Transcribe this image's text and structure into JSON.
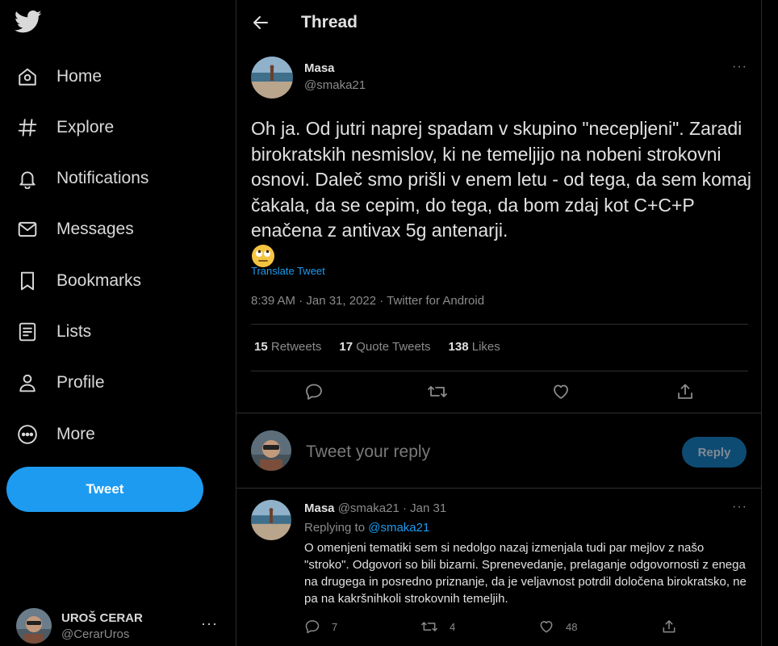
{
  "sidebar": {
    "logo_icon": "twitter-bird-icon",
    "items": [
      {
        "label": "Home",
        "icon": "home-icon"
      },
      {
        "label": "Explore",
        "icon": "hashtag-icon"
      },
      {
        "label": "Notifications",
        "icon": "bell-icon"
      },
      {
        "label": "Messages",
        "icon": "envelope-icon"
      },
      {
        "label": "Bookmarks",
        "icon": "bookmark-icon"
      },
      {
        "label": "Lists",
        "icon": "list-icon"
      },
      {
        "label": "Profile",
        "icon": "person-icon"
      },
      {
        "label": "More",
        "icon": "more-circle-icon"
      }
    ],
    "tweet_button": "Tweet",
    "account": {
      "name": "UROŠ CERAR",
      "handle": "@CerarUros",
      "more": "···"
    }
  },
  "header": {
    "title": "Thread",
    "back_icon": "arrow-left-icon"
  },
  "main_tweet": {
    "author": "Masa",
    "handle": "@smaka21",
    "more": "···",
    "text": "Oh ja. Od jutri naprej spadam v skupino \"necepljeni\". Zaradi birokratskih nesmislov, ki ne temeljijo na nobeni strokovni osnovi. Daleč smo prišli v enem letu - od tega, da sem komaj čakala, da se cepim, do tega, da bom zdaj kot C+C+P enačena z antivax 5g antenarji.",
    "emoji": "rolling-eyes-emoji",
    "translate": "Translate Tweet",
    "meta": "8:39 AM · Jan 31, 2022 · Twitter for Android",
    "stats": {
      "retweets_count": "15",
      "retweets_label": "Retweets",
      "quotes_count": "17",
      "quotes_label": "Quote Tweets",
      "likes_count": "138",
      "likes_label": "Likes"
    }
  },
  "reply_box": {
    "placeholder": "Tweet your reply",
    "button": "Reply"
  },
  "reply_tweet": {
    "author": "Masa",
    "handle_time": "@smaka21 · Jan 31",
    "more": "···",
    "replying_prefix": "Replying to",
    "replying_to": "@smaka21",
    "text": "O omenjeni tematiki sem si nedolgo nazaj izmenjala tudi par mejlov z našo \"stroko\". Odgovori so bili bizarni. Sprenevedanje, prelaganje odgovornosti z enega na drugega in posredno priznanje, da je veljavnost potrdil določena birokratsko, ne pa na kakršnihkoli strokovnih temeljih.",
    "replies": "7",
    "retweets": "4",
    "likes": "48"
  },
  "colors": {
    "accent": "#1d9bf0",
    "background": "#000000",
    "text": "#d9d9d9",
    "muted": "#8b8b8b",
    "border": "#2a2d30"
  }
}
